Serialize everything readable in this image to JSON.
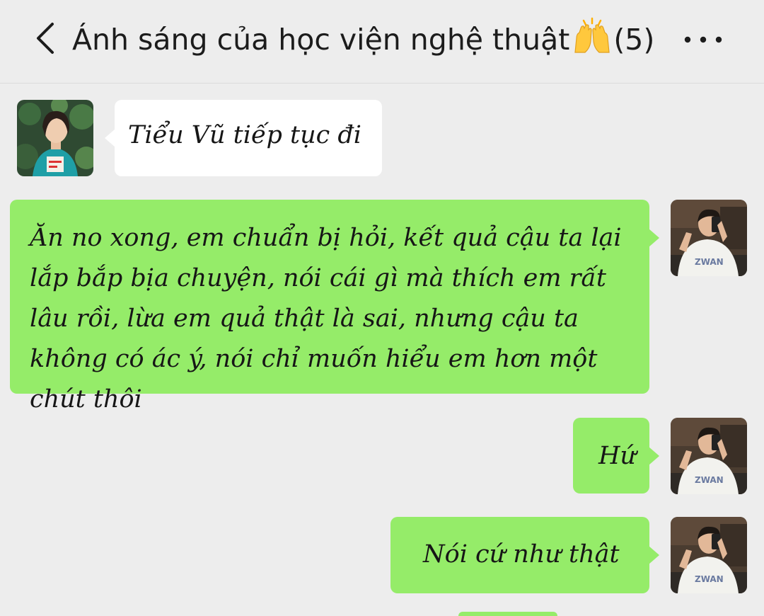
{
  "header": {
    "title": "Ánh sáng của học viện nghệ thuật",
    "emoji": "raising-hands",
    "member_count": "(5)",
    "back_icon": "chevron-left-icon",
    "more_icon": "more-icon"
  },
  "messages": [
    {
      "direction": "incoming",
      "text": "Tiểu Vũ tiếp tục đi"
    },
    {
      "direction": "outgoing",
      "text": "Ăn no xong, em chuẩn bị hỏi, kết quả cậu ta lại lắp bắp bịa chuyện, nói cái gì mà thích em rất lâu rồi, lừa em quả thật là sai, nhưng cậu ta không có ác ý, nói chỉ muốn hiểu em hơn một chút thôi"
    },
    {
      "direction": "outgoing",
      "text": "Hứ"
    },
    {
      "direction": "outgoing",
      "text": "Nói cứ như thật"
    }
  ],
  "colors": {
    "background": "#ededed",
    "outgoing_bubble": "#95ec69",
    "incoming_bubble": "#ffffff",
    "emoji_yellow": "#ffc83d"
  }
}
